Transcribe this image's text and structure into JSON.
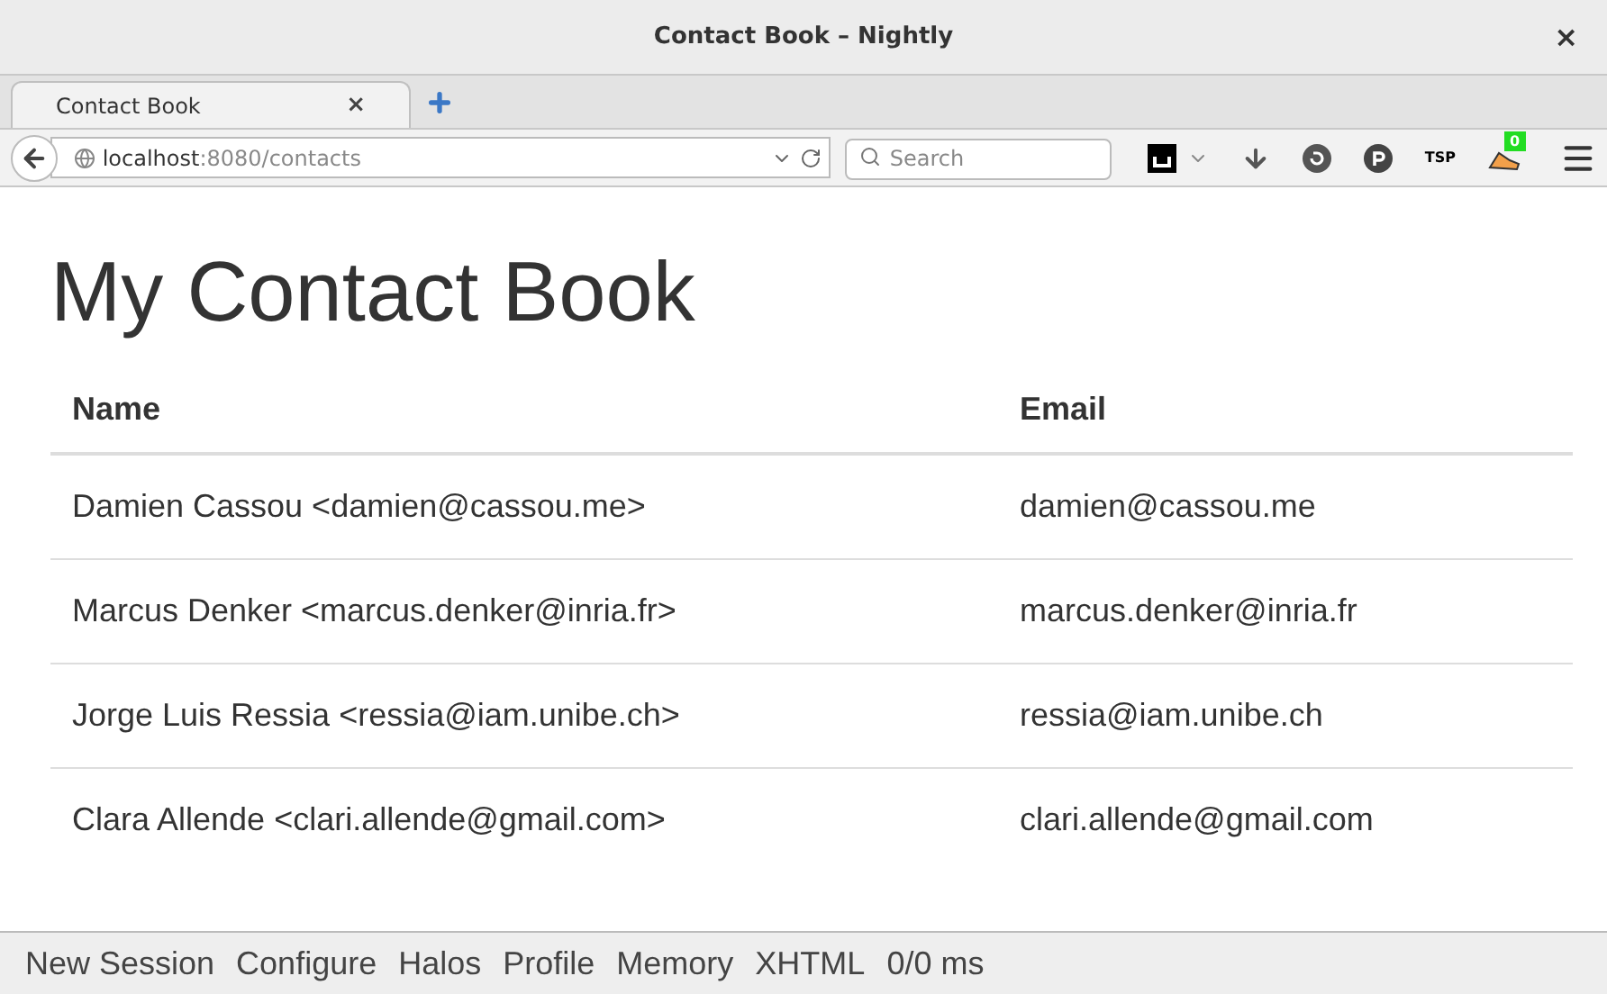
{
  "window": {
    "title": "Contact Book – Nightly",
    "close": "×"
  },
  "tabs": [
    {
      "label": "Contact Book",
      "close": "×",
      "selected": true
    }
  ],
  "address": {
    "host": "localhost",
    "path": ":8080/contacts"
  },
  "search": {
    "placeholder": "Search"
  },
  "toolbar": {
    "badge": "0",
    "tsp": "TSP"
  },
  "page": {
    "heading": "My Contact Book",
    "table": {
      "columns": [
        "Name",
        "Email"
      ],
      "rows": [
        [
          "Damien Cassou <damien@cassou.me>",
          "damien@cassou.me"
        ],
        [
          "Marcus Denker <marcus.denker@inria.fr>",
          "marcus.denker@inria.fr"
        ],
        [
          "Jorge Luis Ressia <ressia@iam.unibe.ch>",
          "ressia@iam.unibe.ch"
        ],
        [
          "Clara Allende <clari.allende@gmail.com>",
          "clari.allende@gmail.com"
        ]
      ]
    }
  },
  "footer": [
    "New Session",
    "Configure",
    "Halos",
    "Profile",
    "Memory",
    "XHTML",
    "0/0 ms"
  ]
}
